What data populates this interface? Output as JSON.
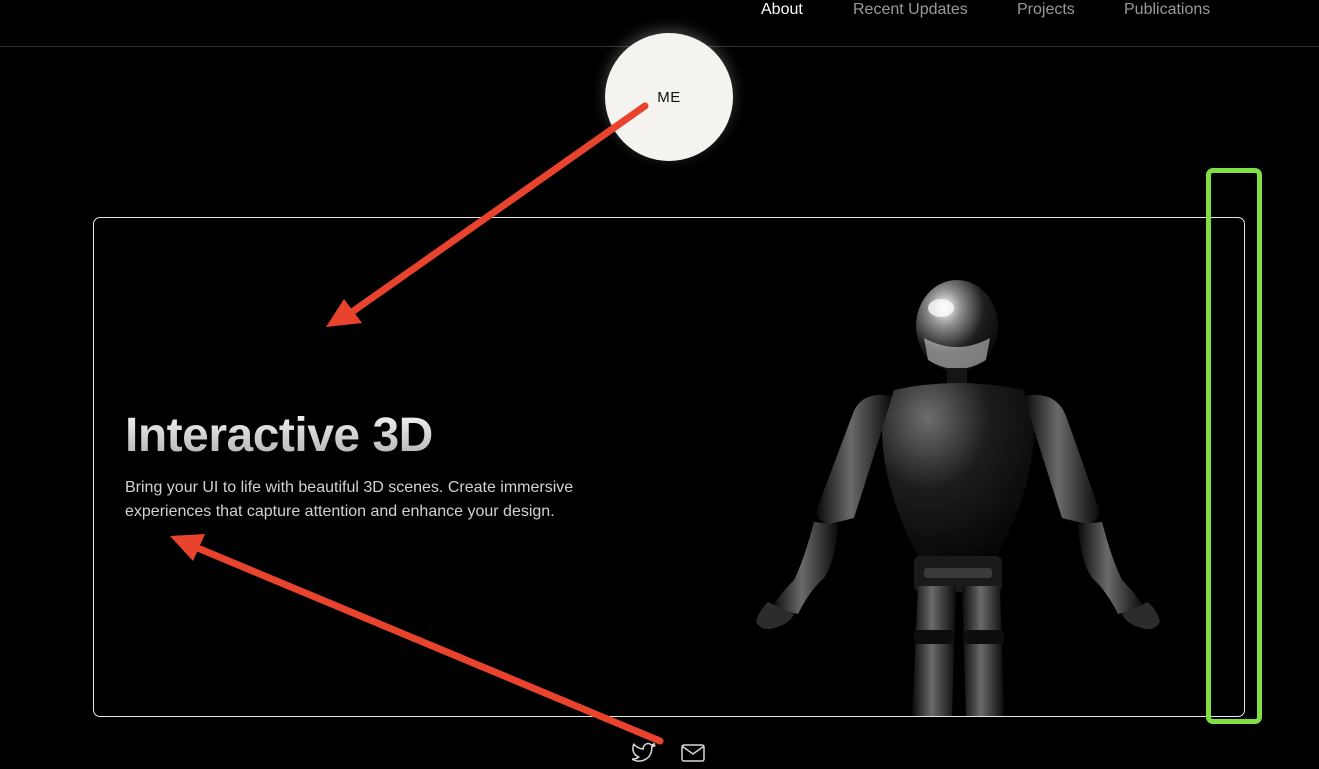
{
  "nav": {
    "items": [
      {
        "label": "About",
        "active": true
      },
      {
        "label": "Recent Updates",
        "active": false
      },
      {
        "label": "Projects",
        "active": false
      },
      {
        "label": "Publications",
        "active": false
      }
    ]
  },
  "avatar": {
    "text": "ME"
  },
  "hero": {
    "title": "Interactive 3D",
    "description": "Bring your UI to life with beautiful 3D scenes. Create immersive experiences that capture attention and enhance your design."
  },
  "social": {
    "icons": [
      "twitter-icon",
      "mail-icon"
    ]
  },
  "annotations": {
    "arrow_color": "#e8432c",
    "highlight_color": "#7ee043"
  }
}
